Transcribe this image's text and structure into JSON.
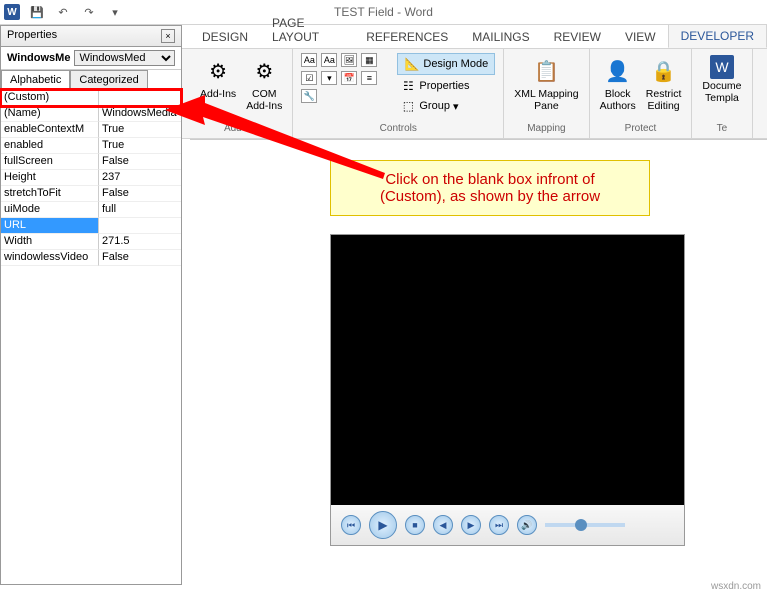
{
  "titlebar": {
    "title": "TEST Field - Word"
  },
  "qat": {
    "save": "💾",
    "undo": "↶",
    "redo": "↷"
  },
  "tabs": [
    "DESIGN",
    "PAGE LAYOUT",
    "REFERENCES",
    "MAILINGS",
    "REVIEW",
    "VIEW",
    "DEVELOPER"
  ],
  "ribbon": {
    "addins": {
      "label": "Add-Ins",
      "addins_btn": "Add-Ins",
      "com_btn": "COM\nAdd-Ins"
    },
    "controls": {
      "label": "Controls",
      "design_mode": "Design Mode",
      "properties": "Properties",
      "group": "Group"
    },
    "mapping": {
      "label": "Mapping",
      "btn": "XML Mapping\nPane"
    },
    "protect": {
      "label": "Protect",
      "block": "Block\nAuthors",
      "restrict": "Restrict\nEditing"
    },
    "templates": {
      "label": "Te",
      "btn": "Docume\nTempla"
    }
  },
  "properties": {
    "title": "Properties",
    "object_name": "WindowsMe",
    "object_type": "WindowsMed",
    "tab_alpha": "Alphabetic",
    "tab_cat": "Categorized",
    "rows": [
      {
        "k": "(Custom)",
        "v": ""
      },
      {
        "k": "(Name)",
        "v": "WindowsMedia"
      },
      {
        "k": "enableContextM",
        "v": "True"
      },
      {
        "k": "enabled",
        "v": "True"
      },
      {
        "k": "fullScreen",
        "v": "False"
      },
      {
        "k": "Height",
        "v": "237"
      },
      {
        "k": "stretchToFit",
        "v": "False"
      },
      {
        "k": "uiMode",
        "v": "full"
      },
      {
        "k": "URL",
        "v": ""
      },
      {
        "k": "Width",
        "v": "271.5"
      },
      {
        "k": "windowlessVideo",
        "v": "False"
      }
    ]
  },
  "callout": {
    "line1": "Click on the blank box infront of",
    "line2": "(Custom), as shown by the arrow"
  },
  "watermark": "wsxdn.com"
}
